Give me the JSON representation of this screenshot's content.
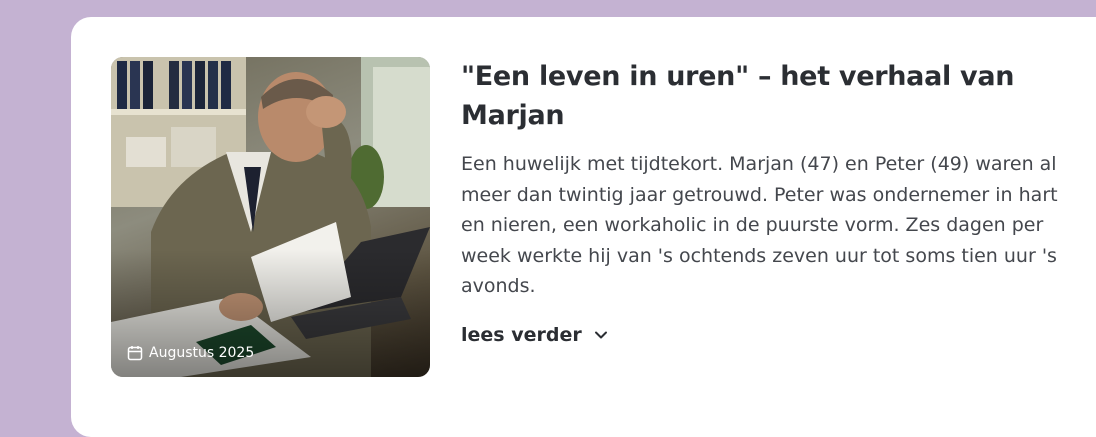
{
  "article": {
    "title": "\"Een leven in uren\" – het verhaal van Marjan",
    "excerpt": "Een huwelijk met tijdtekort. Marjan (47) en Peter (49) waren al meer dan twintig jaar getrouwd. Peter was ondernemer in hart en nieren, een workaholic in de puurste vorm. Zes dagen per week werkte hij van 's ochtends zeven uur tot soms tien uur 's avonds.",
    "date": "Augustus 2025",
    "read_more_label": "lees verder",
    "image_icon": "stressed-businessman-photo",
    "date_icon": "calendar-icon",
    "read_more_icon": "chevron-down-icon"
  },
  "colors": {
    "page_background": "#c4b2d2",
    "card_background": "#ffffff",
    "title_text": "#2b2e33",
    "body_text": "#44474d"
  }
}
